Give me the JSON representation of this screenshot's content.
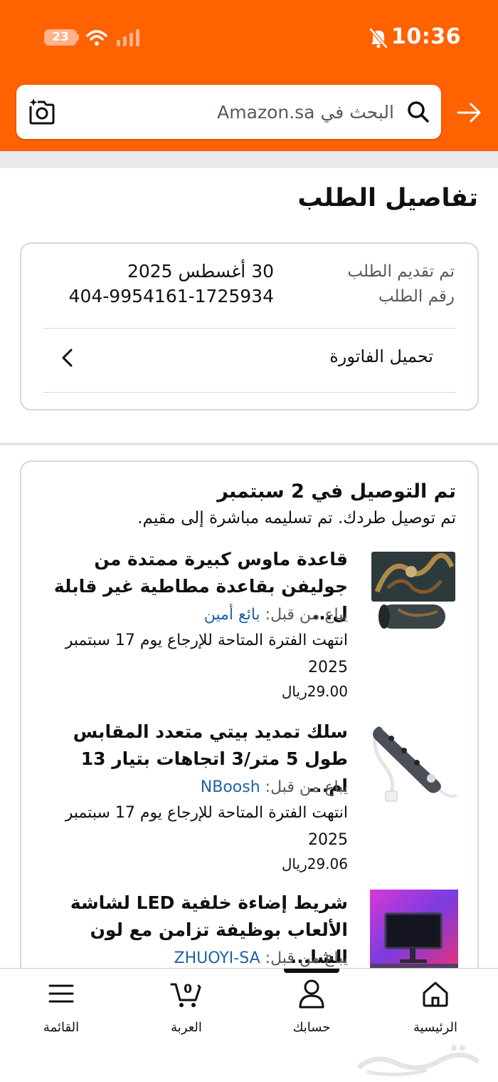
{
  "status_bar": {
    "battery": "23",
    "time": "10:36"
  },
  "search": {
    "placeholder": "البحث في Amazon.sa"
  },
  "page": {
    "title": "تفاصيل الطلب"
  },
  "order_summary": {
    "placed_label": "تم تقديم الطلب",
    "placed_date": "30 أغسطس 2025",
    "number_label": "رقم الطلب",
    "order_number": "404-9954161-1725934",
    "invoice_label": "تحميل الفاتورة"
  },
  "delivery": {
    "title": "تم التوصيل في 2 سبتمبر",
    "subtitle": "تم توصيل طردك. تم تسليمه مباشرة إلى مقيم.",
    "sold_by_label": "يباع من قبل:",
    "items": [
      {
        "title": "قاعدة ماوس كبيرة ممتدة من جوليفن بقاعدة مطاطية غير قابلة ل...",
        "seller": "بائع أمين",
        "return_note": "انتهت الفترة المتاحة للإرجاع يوم 17 سبتمبر 2025",
        "price": "29.00ريال"
      },
      {
        "title": "سلك تمديد بيتي متعدد المقابس طول 5 متر/3 اتجاهات بتيار 13 ام...",
        "seller": "NBoosh",
        "return_note": "انتهت الفترة المتاحة للإرجاع يوم 17 سبتمبر 2025",
        "price": "29.06ريال"
      },
      {
        "title": "شريط إضاءة خلفية LED لشاشة الألعاب بوظيفة تزامن مع لون الشا...",
        "seller": "ZHUOYI-SA"
      }
    ]
  },
  "bottom_nav": {
    "home": "الرئيسية",
    "account": "حسابك",
    "cart": "العربة",
    "cart_count": "0",
    "menu": "القائمة"
  },
  "colors": {
    "header": "#ff6200",
    "link": "#2162a1",
    "text": "#0f1111",
    "muted": "#565959"
  }
}
